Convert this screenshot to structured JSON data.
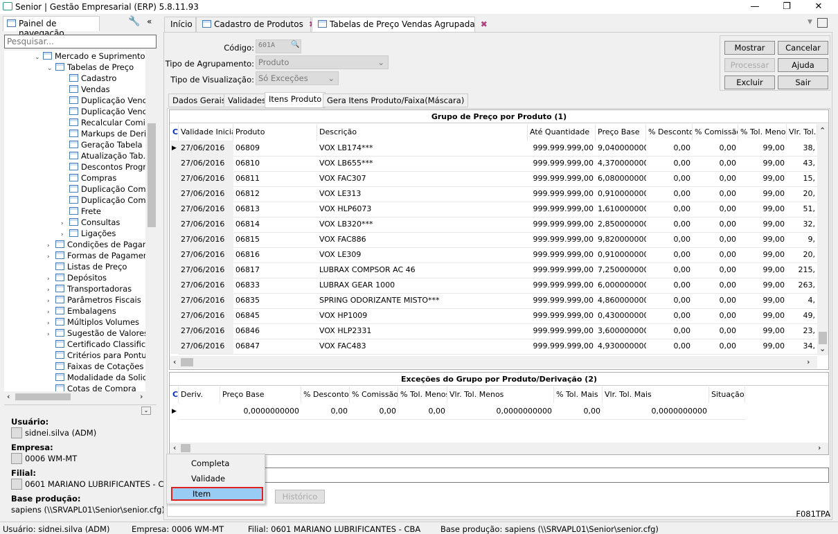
{
  "window": {
    "title": "Senior | Gestão Empresarial (ERP) 5.8.11.93",
    "minimize": "—",
    "maximize": "❐",
    "close": "✕"
  },
  "nav": {
    "tab": "Painel de navegação",
    "search_placeholder": "Pesquisar...",
    "tree": [
      {
        "label": "Mercado e Suprimentos",
        "level": 1,
        "chev": "v"
      },
      {
        "label": "Tabelas de Preço",
        "level": 2,
        "chev": "v"
      },
      {
        "label": "Cadastro",
        "level": 3
      },
      {
        "label": "Vendas",
        "level": 3
      },
      {
        "label": "Duplicação Venc",
        "level": 3
      },
      {
        "label": "Duplicação Venc",
        "level": 3
      },
      {
        "label": "Recalcular Comis",
        "level": 3
      },
      {
        "label": "Markups de Deri",
        "level": 3
      },
      {
        "label": "Geração Tabela c",
        "level": 3
      },
      {
        "label": "Atualização Tab.",
        "level": 3
      },
      {
        "label": "Descontos Progr",
        "level": 3
      },
      {
        "label": "Compras",
        "level": 3
      },
      {
        "label": "Duplicação Com",
        "level": 3
      },
      {
        "label": "Duplicação Com",
        "level": 3
      },
      {
        "label": "Frete",
        "level": 3
      },
      {
        "label": "Consultas",
        "level": 3,
        "chev": ">"
      },
      {
        "label": "Ligações",
        "level": 3,
        "chev": ">"
      },
      {
        "label": "Condições de Pagan",
        "level": 2,
        "chev": ">"
      },
      {
        "label": "Formas de Pagamen",
        "level": 2,
        "chev": ">"
      },
      {
        "label": "Listas de Preço",
        "level": 2
      },
      {
        "label": "Depósitos",
        "level": 2,
        "chev": ">"
      },
      {
        "label": "Transportadoras",
        "level": 2,
        "chev": ">"
      },
      {
        "label": "Parâmetros Fiscais",
        "level": 2,
        "chev": ">"
      },
      {
        "label": "Embalagens",
        "level": 2,
        "chev": ">"
      },
      {
        "label": "Múltiplos Volumes",
        "level": 2,
        "chev": ">"
      },
      {
        "label": "Sugestão de Valores",
        "level": 2,
        "chev": ">"
      },
      {
        "label": "Certificado Classifica",
        "level": 2
      },
      {
        "label": "Critérios para Pontu",
        "level": 2
      },
      {
        "label": "Faixas de Cotações",
        "level": 2
      },
      {
        "label": "Modalidade da Solic",
        "level": 2
      },
      {
        "label": "Cotas de Compra",
        "level": 2
      }
    ],
    "info": {
      "usuario_label": "Usuário:",
      "usuario": "sidnei.silva (ADM)",
      "empresa_label": "Empresa:",
      "empresa": "0006 WM-MT",
      "filial_label": "Filial:",
      "filial": "0601 MARIANO LUBRIFICANTES - CBA",
      "base_label": "Base produção:",
      "base": "sapiens (\\\\SRVAPL01\\Senior\\senior.cfg)"
    }
  },
  "doc_tabs": [
    {
      "label": "Início"
    },
    {
      "label": "Cadastro de Produtos"
    },
    {
      "label": "Tabelas de Preço Vendas Agrupada",
      "active": true
    }
  ],
  "form": {
    "codigo_label": "Código:",
    "codigo": "601A",
    "agrup_label": "Tipo de Agrupamento:",
    "agrup": "Produto",
    "visual_label": "Tipo de Visualização:",
    "visual": "Só Exceções",
    "buttons": {
      "mostrar": "Mostrar",
      "cancelar": "Cancelar",
      "processar": "Processar",
      "ajuda": "Ajuda",
      "excluir": "Excluir",
      "sair": "Sair",
      "historico": "Histórico"
    },
    "inner_tabs": [
      "Dados Gerais",
      "Validades",
      "Itens Produto",
      "Gera Itens Produto/Faixa(Máscara)"
    ],
    "code": "F081TPA"
  },
  "grid1": {
    "title": "Grupo de Preço por Produto (1)",
    "headers": [
      "C",
      "Validade Inicia",
      "Produto",
      "Descrição",
      "Até Quantidade",
      "Preço Base",
      "% Desconto",
      "% Comissão",
      "% Tol. Menos",
      "Vlr. Tol."
    ],
    "rows": [
      [
        "27/06/2016",
        "06809",
        "VOX LB174***",
        "999.999.999,00",
        "9,0400000000",
        "0,00",
        "0,00",
        "99,00",
        "38,"
      ],
      [
        "27/06/2016",
        "06810",
        "VOX LB655***",
        "999.999.999,00",
        "4,3700000000",
        "0,00",
        "0,00",
        "99,00",
        "43,"
      ],
      [
        "27/06/2016",
        "06811",
        "VOX FAC307",
        "999.999.999,00",
        "6,0800000000",
        "0,00",
        "0,00",
        "99,00",
        "15,"
      ],
      [
        "27/06/2016",
        "06812",
        "VOX LE313",
        "999.999.999,00",
        "0,9100000000",
        "0,00",
        "0,00",
        "99,00",
        "20,"
      ],
      [
        "27/06/2016",
        "06813",
        "VOX HLP6073",
        "999.999.999,00",
        "1,6100000000",
        "0,00",
        "0,00",
        "99,00",
        "51,"
      ],
      [
        "27/06/2016",
        "06814",
        "VOX LB320***",
        "999.999.999,00",
        "2,8500000000",
        "0,00",
        "0,00",
        "99,00",
        "32,"
      ],
      [
        "27/06/2016",
        "06815",
        "VOX FAC886",
        "999.999.999,00",
        "9,8200000000",
        "0,00",
        "0,00",
        "99,00",
        "9,"
      ],
      [
        "27/06/2016",
        "06816",
        "VOX LE309",
        "999.999.999,00",
        "0,9100000000",
        "0,00",
        "0,00",
        "99,00",
        "20,"
      ],
      [
        "27/06/2016",
        "06817",
        "LUBRAX COMPSOR AC 46",
        "999.999.999,00",
        "7,2500000000",
        "0,00",
        "0,00",
        "99,00",
        "215,"
      ],
      [
        "27/06/2016",
        "06833",
        "LUBRAX GEAR 1000",
        "999.999.999,00",
        "6,0000000000",
        "0,00",
        "0,00",
        "99,00",
        "263,"
      ],
      [
        "27/06/2016",
        "06835",
        "SPRING ODORIZANTE MISTO***",
        "999.999.999,00",
        "4,8600000000",
        "0,00",
        "0,00",
        "99,00",
        "4,"
      ],
      [
        "27/06/2016",
        "06845",
        "VOX HP1009",
        "999.999.999,00",
        "0,4300000000",
        "0,00",
        "0,00",
        "99,00",
        "49,"
      ],
      [
        "27/06/2016",
        "06846",
        "VOX HLP2331",
        "999.999.999,00",
        "3,6000000000",
        "0,00",
        "0,00",
        "99,00",
        "23,"
      ],
      [
        "27/06/2016",
        "06847",
        "VOX FAC483",
        "999.999.999,00",
        "4,9300000000",
        "0,00",
        "0,00",
        "99,00",
        "34,"
      ]
    ]
  },
  "grid2": {
    "title": "Exceções do Grupo por Produto/Derivação (2)",
    "headers": [
      "C",
      "Deriv.",
      "Preço Base",
      "% Desconto",
      "% Comissão",
      "% Tol. Menos",
      "Vlr. Tol. Menos",
      "% Tol. Mais",
      "Vlr. Tol. Mais",
      "Situação"
    ],
    "rows": [
      [
        "",
        "0,0000000000",
        "0,00",
        "0,00",
        "0,00",
        "0,0000000000",
        "0,00",
        "0,0000000000",
        ""
      ]
    ]
  },
  "menu": {
    "items": [
      "Completa",
      "Validade",
      "Item"
    ],
    "selected": "Item"
  },
  "status": {
    "usuario": "Usuário: sidnei.silva (ADM)",
    "empresa": "Empresa: 0006 WM-MT",
    "filial": "Filial: 0601 MARIANO LUBRIFICANTES - CBA",
    "base": "Base produção: sapiens (\\\\SRVAPL01\\Senior\\senior.cfg)"
  }
}
